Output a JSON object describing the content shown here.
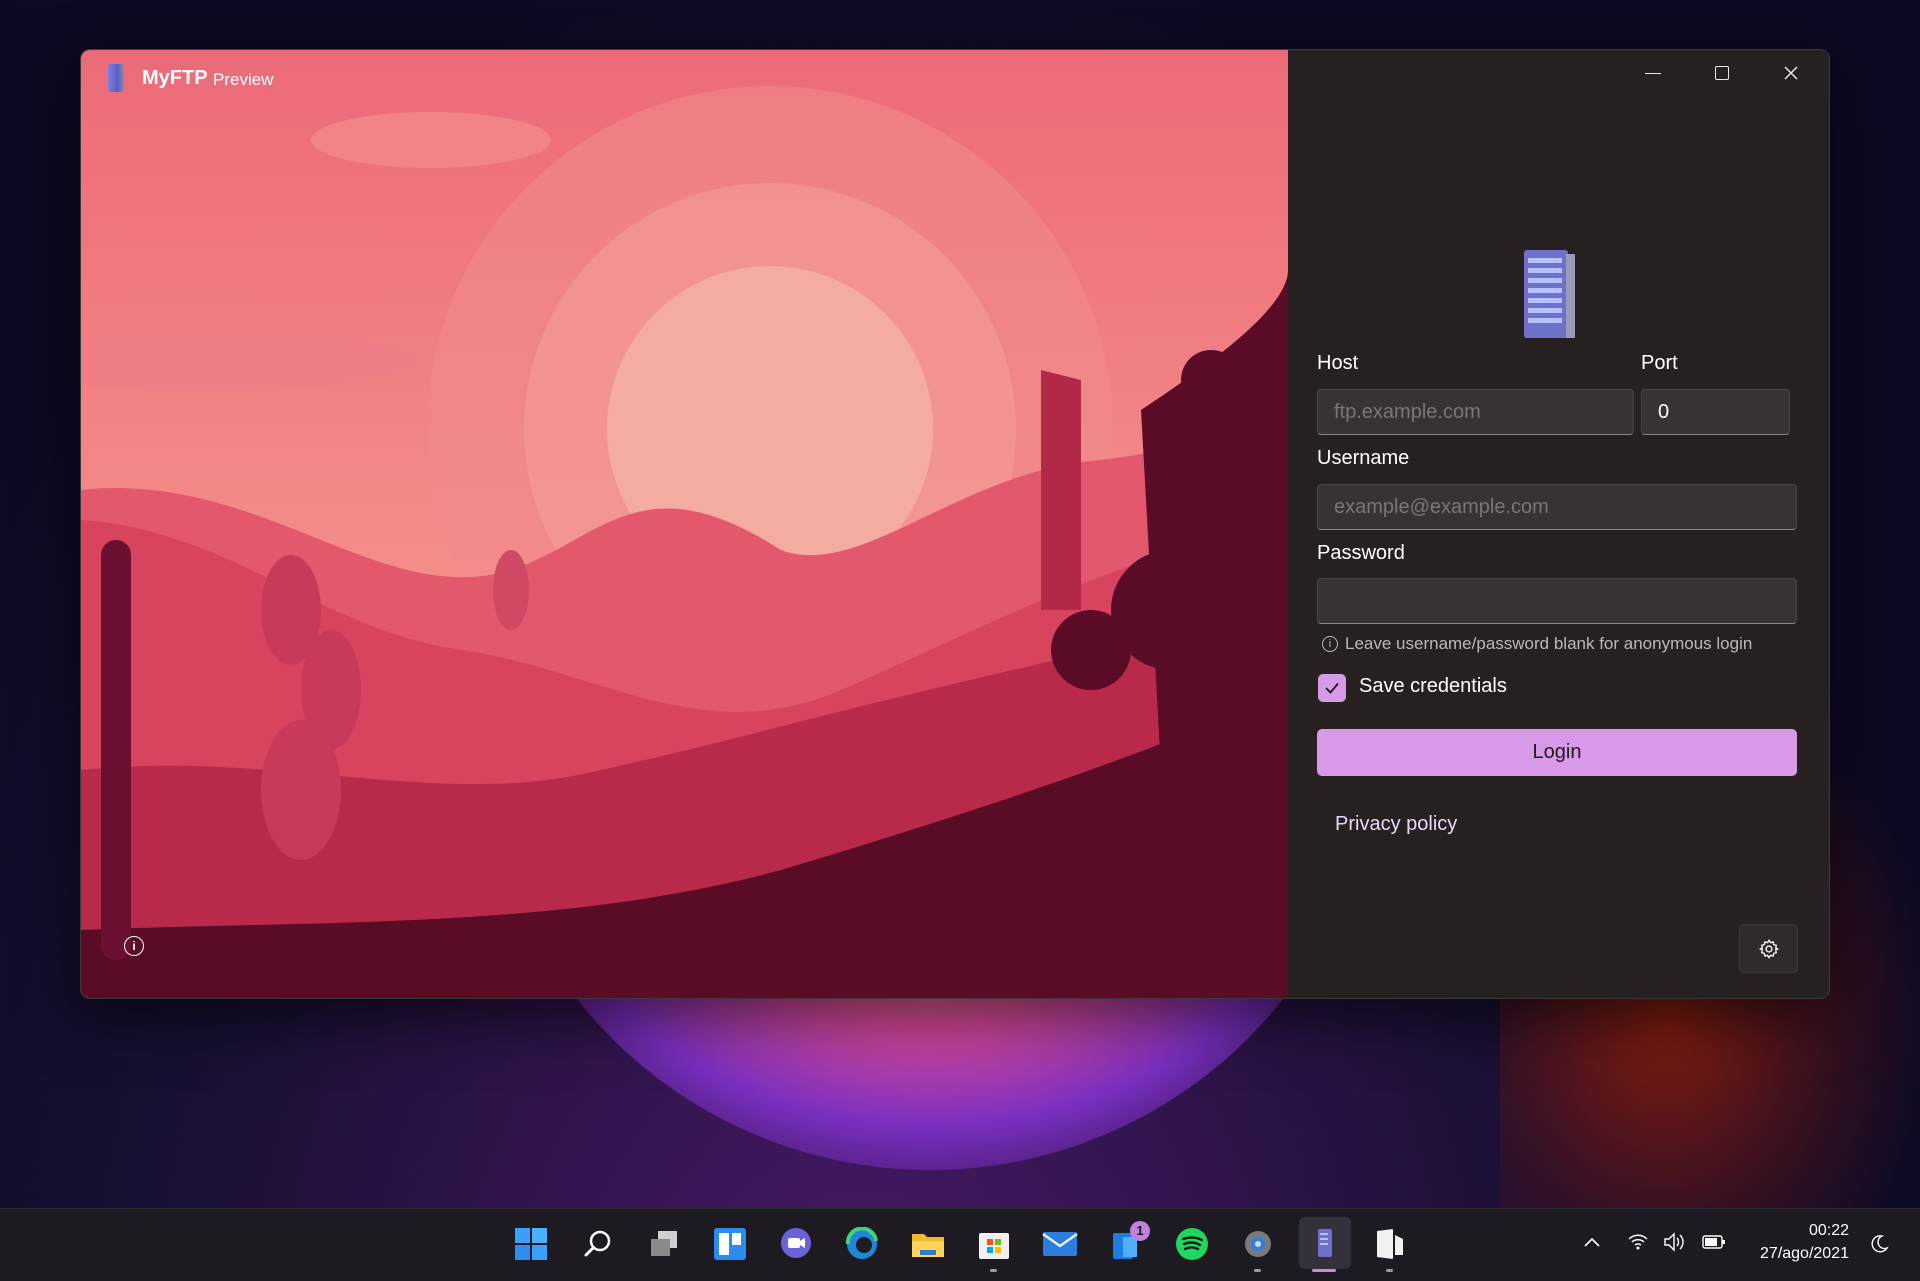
{
  "window": {
    "title": "MyFTP",
    "subtitle": "Preview",
    "controls": {
      "minimize": "minimize-icon",
      "maximize": "maximize-icon",
      "close": "close-icon"
    }
  },
  "login_form": {
    "host_label": "Host",
    "host_placeholder": "ftp.example.com",
    "host_value": "",
    "port_label": "Port",
    "port_value": "0",
    "username_label": "Username",
    "username_placeholder": "example@example.com",
    "username_value": "",
    "password_label": "Password",
    "password_value": "",
    "hint": "Leave username/password blank for anonymous login",
    "save_credentials_label": "Save credentials",
    "save_credentials_checked": true,
    "login_button": "Login",
    "privacy_link": "Privacy policy"
  },
  "icons": {
    "settings": "gear-icon",
    "info": "info-icon"
  },
  "colors": {
    "accent": "#d89ae8",
    "panel_bg": "#272020"
  },
  "taskbar": {
    "apps": [
      {
        "name": "start-button",
        "running": false
      },
      {
        "name": "search-button",
        "running": false
      },
      {
        "name": "task-view-button",
        "running": false
      },
      {
        "name": "widgets-button",
        "running": false
      },
      {
        "name": "teams-chat-button",
        "running": false
      },
      {
        "name": "edge-button",
        "running": false
      },
      {
        "name": "file-explorer-button",
        "running": false
      },
      {
        "name": "microsoft-store-button",
        "running": true
      },
      {
        "name": "mail-button",
        "running": false
      },
      {
        "name": "phone-link-button",
        "running": false,
        "badge": "1"
      },
      {
        "name": "spotify-button",
        "running": false
      },
      {
        "name": "settings-app-button",
        "running": true
      },
      {
        "name": "myftp-taskbar-button",
        "running": true,
        "active": true
      },
      {
        "name": "unknown-app-button",
        "running": true
      }
    ],
    "badge_count": "1",
    "clock_time": "00:22",
    "clock_date": "27/ago/2021"
  }
}
